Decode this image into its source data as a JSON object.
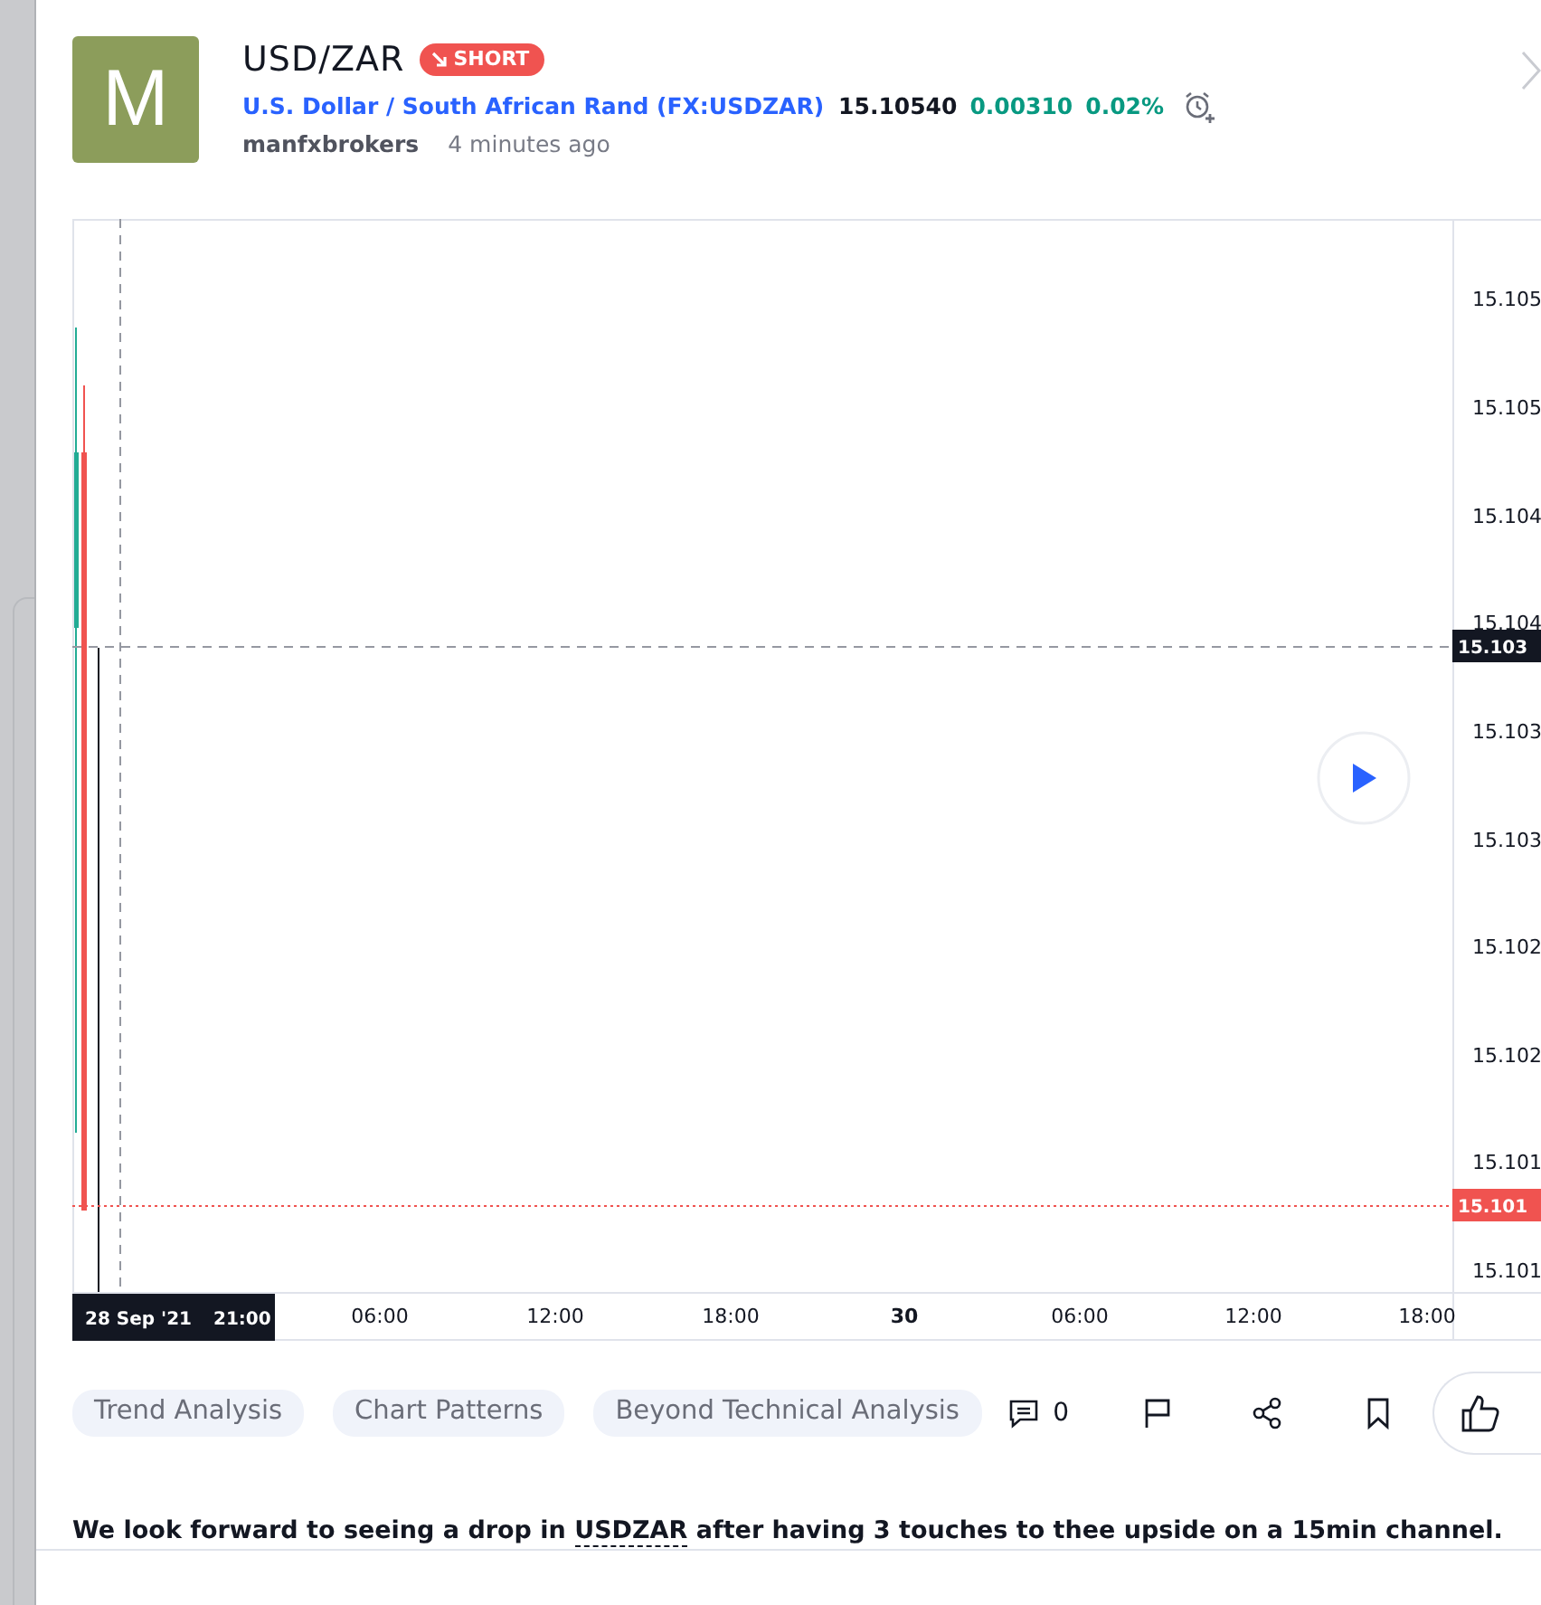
{
  "idea": {
    "author_initial": "M",
    "symbol": "USD/ZAR",
    "direction": {
      "label": "SHORT",
      "kind": "short"
    },
    "instrument": "U.S. Dollar / South African Rand",
    "ticker": "(FX:USDZAR)",
    "price": "15.10540",
    "change": "0.00310",
    "change_percent": "0.02%",
    "author": "manfxbrokers",
    "time": "4 minutes ago"
  },
  "chart": {
    "price_labels": [
      "15.105",
      "15.105",
      "15.104",
      "15.104",
      "15.103",
      "15.103",
      "15.102",
      "15.102",
      "15.101",
      "15.101"
    ],
    "crosshair_price": "15.103",
    "last_price": "15.101",
    "date_badge": {
      "date": "28 Sep '21",
      "time": "21:00"
    },
    "time_labels": [
      {
        "text": "06:00",
        "kind": "time"
      },
      {
        "text": "12:00",
        "kind": "time"
      },
      {
        "text": "18:00",
        "kind": "time"
      },
      {
        "text": "30",
        "kind": "day"
      },
      {
        "text": "06:00",
        "kind": "time"
      },
      {
        "text": "12:00",
        "kind": "time"
      },
      {
        "text": "18:00",
        "kind": "time"
      }
    ]
  },
  "tags": [
    "Trend Analysis",
    "Chart Patterns",
    "Beyond Technical Analysis"
  ],
  "comments_count": "0",
  "description": {
    "before": "We look forward to seeing a drop in",
    "link": "USDZAR",
    "after": "after having 3 touches to thee upside on a 15min channel."
  }
}
